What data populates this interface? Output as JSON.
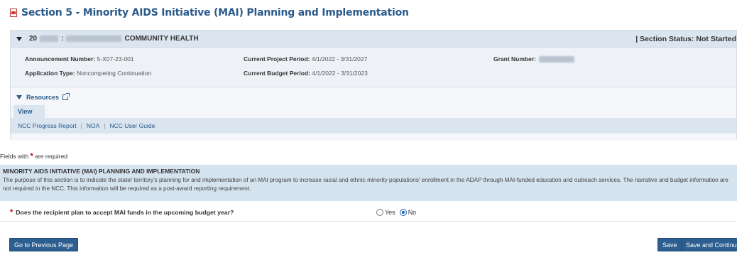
{
  "page": {
    "title": "Section 5 - Minority AIDS Initiative (MAI) Planning and Implementation"
  },
  "org": {
    "id_prefix": "20",
    "name_suffix": "COMMUNITY HEALTH",
    "section_status": "| Section Status: Not Started"
  },
  "info": {
    "announcement_label": "Announcement Number:",
    "announcement_value": "5-X07-23-001",
    "application_type_label": "Application Type:",
    "application_type_value": "Noncompeting Continuation",
    "project_period_label": "Current Project Period:",
    "project_period_value": "4/1/2022 - 3/31/2027",
    "budget_period_label": "Current Budget Period:",
    "budget_period_value": "4/1/2022 - 3/31/2023",
    "grant_number_label": "Grant Number:"
  },
  "resources": {
    "header": "Resources",
    "view_tab": "View",
    "links": [
      "NCC Progress Report",
      "NOA",
      "NCC User Guide"
    ],
    "separator": "|"
  },
  "form": {
    "required_note_prefix": "Fields with",
    "required_note_suffix": "are required",
    "required_marker": "*",
    "section_title": "MINORITY AIDS INITIATIVE (MAI) PLANNING AND IMPLEMENTATION",
    "section_desc": "The purpose of this section is to indicate the state/ territory's planning for and implementation of an MAI program to increase racial and ethnic minority populations' enrollment in the ADAP through MAI-funded education and outreach services. The narrative and budget information are not required in the NCC. This information will be required as a post-award reporting requirement.",
    "question": "Does the recipient plan to accept MAI funds in the upcoming budget year?",
    "option_yes": "Yes",
    "option_no": "No",
    "selected": "No"
  },
  "buttons": {
    "prev": "Go to Previous Page",
    "save": "Save",
    "save_continue": "Save and Continue"
  }
}
